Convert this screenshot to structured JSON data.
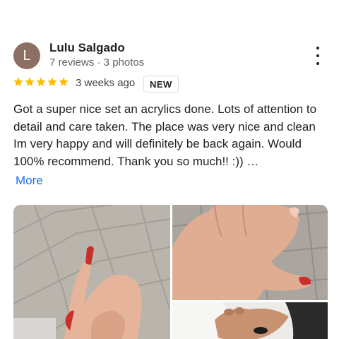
{
  "review": {
    "author": {
      "initial": "L",
      "name": "Lulu Salgado",
      "meta": "7 reviews · 3 photos",
      "avatar_color": "#8d6e63"
    },
    "rating": 5,
    "star_color": "#fbbc04",
    "time": "3 weeks ago",
    "badge": "NEW",
    "text": "Got a super nice set an acrylics done. Lots of attention to detail and care taken. The place was very nice and clean Im very happy and will definitely be back again. Would 100% recommend. Thank you so much!! :)) …",
    "more_label": "More",
    "link_color": "#1a73e8",
    "menu_icon": "more-vert-icon"
  }
}
